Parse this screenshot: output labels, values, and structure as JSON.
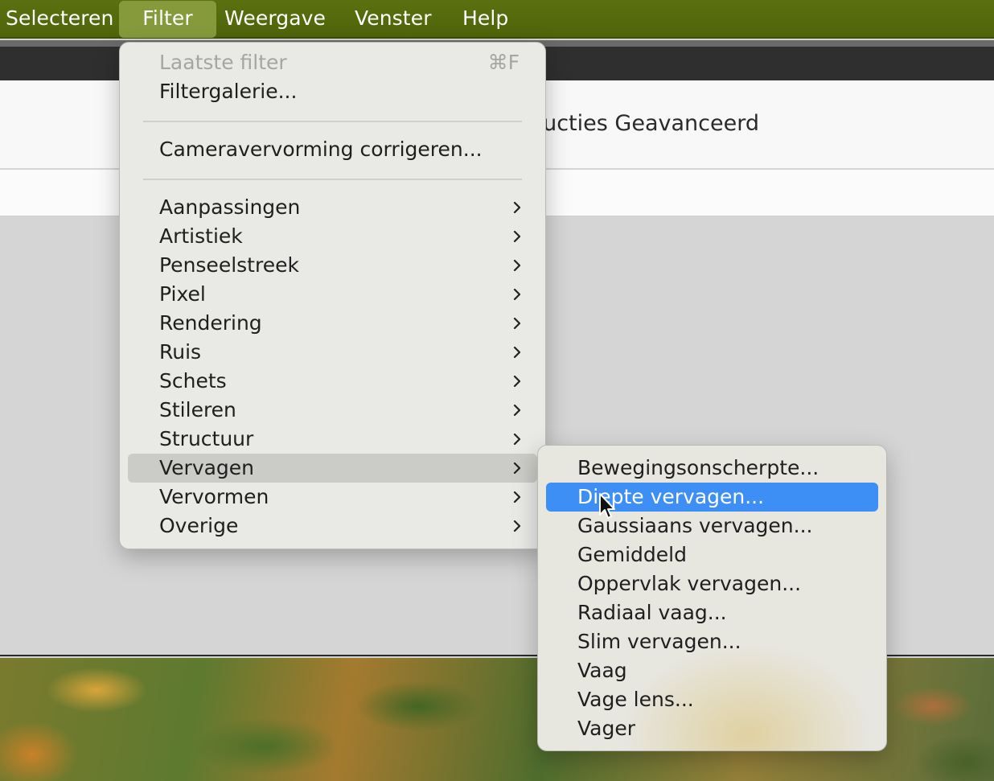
{
  "menubar": {
    "items": [
      {
        "label": "Selecteren",
        "active": false
      },
      {
        "label": "Filter",
        "active": true
      },
      {
        "label": "Weergave",
        "active": false
      },
      {
        "label": "Venster",
        "active": false
      },
      {
        "label": "Help",
        "active": false
      }
    ]
  },
  "background": {
    "panel_title": "ructies Geavanceerd"
  },
  "filter_menu": {
    "last_filter": {
      "label": "Laatste filter",
      "shortcut": "⌘F",
      "disabled": true
    },
    "gallery": "Filtergalerie...",
    "camera_distortion": "Cameravervorming corrigeren...",
    "submenus": [
      {
        "label": "Aanpassingen"
      },
      {
        "label": "Artistiek"
      },
      {
        "label": "Penseelstreek"
      },
      {
        "label": "Pixel"
      },
      {
        "label": "Rendering"
      },
      {
        "label": "Ruis"
      },
      {
        "label": "Schets"
      },
      {
        "label": "Stileren"
      },
      {
        "label": "Structuur"
      },
      {
        "label": "Vervagen",
        "highlighted": true
      },
      {
        "label": "Vervormen"
      },
      {
        "label": "Overige"
      }
    ]
  },
  "blur_submenu": {
    "items": [
      {
        "label": "Bewegingsonscherpte..."
      },
      {
        "label": "Diepte vervagen...",
        "selected": true
      },
      {
        "label": "Gaussiaans vervagen..."
      },
      {
        "label": "Gemiddeld"
      },
      {
        "label": "Oppervlak vervagen..."
      },
      {
        "label": "Radiaal vaag..."
      },
      {
        "label": "Slim vervagen..."
      },
      {
        "label": "Vaag"
      },
      {
        "label": "Vage lens..."
      },
      {
        "label": "Vager"
      }
    ]
  },
  "colors": {
    "menubar_bg": "#56690d",
    "menu_bg": "#e9e9e6",
    "selection_blue": "#3d8ff5",
    "hover_gray": "#cbcbc7"
  }
}
